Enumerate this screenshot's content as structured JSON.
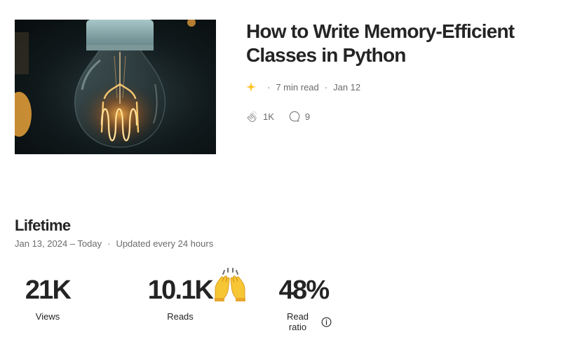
{
  "story": {
    "title": "How to Write Memory-Efficient Classes in Python",
    "image_icon": "light-bulb-photo",
    "member_badge_icon": "sparkle-icon",
    "badge_color": "#ffc017",
    "read_time": "7 min read",
    "date": "Jan 12",
    "claps": "1K",
    "responses": "9"
  },
  "lifetime": {
    "heading": "Lifetime",
    "date_range": "Jan 13, 2024 – Today",
    "update_note": "Updated every 24 hours"
  },
  "metrics": [
    {
      "value": "21K",
      "label": "Views"
    },
    {
      "value": "10.1K",
      "label": "Reads"
    },
    {
      "value": "48%",
      "label": "Read ratio"
    }
  ],
  "icons": {
    "clap": "clap-icon",
    "response": "response-bubble-icon",
    "info": "info-icon",
    "celebration": "raised-hands-icon"
  }
}
